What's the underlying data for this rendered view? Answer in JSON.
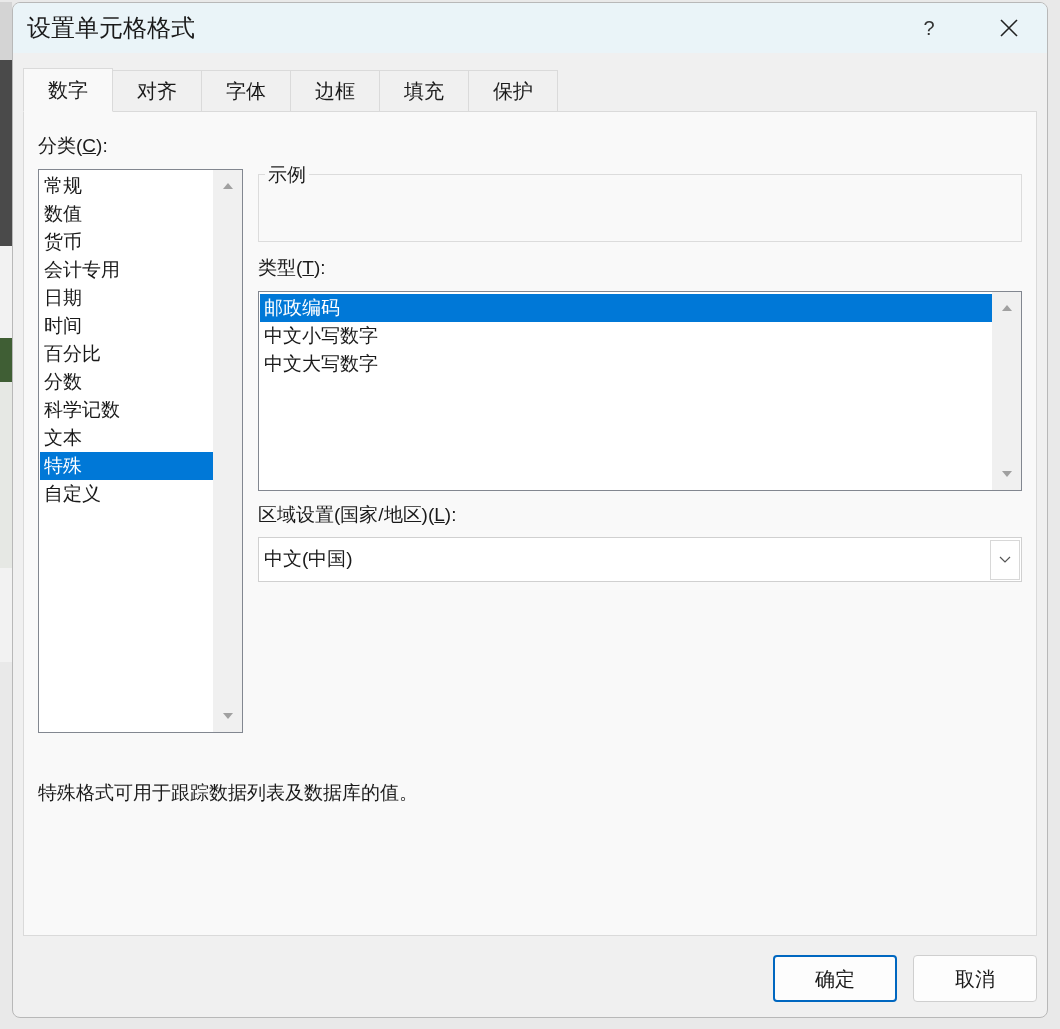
{
  "window": {
    "title": "设置单元格格式",
    "help": "?"
  },
  "tabs": [
    {
      "label": "数字",
      "selected": true
    },
    {
      "label": "对齐",
      "selected": false
    },
    {
      "label": "字体",
      "selected": false
    },
    {
      "label": "边框",
      "selected": false
    },
    {
      "label": "填充",
      "selected": false
    },
    {
      "label": "保护",
      "selected": false
    }
  ],
  "category": {
    "label": [
      "分类(",
      "C",
      "):"
    ],
    "items": [
      {
        "label": "常规",
        "selected": false
      },
      {
        "label": "数值",
        "selected": false
      },
      {
        "label": "货币",
        "selected": false
      },
      {
        "label": "会计专用",
        "selected": false
      },
      {
        "label": "日期",
        "selected": false
      },
      {
        "label": "时间",
        "selected": false
      },
      {
        "label": "百分比",
        "selected": false
      },
      {
        "label": "分数",
        "selected": false
      },
      {
        "label": "科学记数",
        "selected": false
      },
      {
        "label": "文本",
        "selected": false
      },
      {
        "label": "特殊",
        "selected": true
      },
      {
        "label": "自定义",
        "selected": false
      }
    ]
  },
  "sample": {
    "label": "示例"
  },
  "type": {
    "label": [
      "类型(",
      "T",
      "):"
    ],
    "items": [
      {
        "label": "邮政编码",
        "selected": true
      },
      {
        "label": "中文小写数字",
        "selected": false
      },
      {
        "label": "中文大写数字",
        "selected": false
      }
    ]
  },
  "locale": {
    "label": [
      "区域设置(国家/地区)(",
      "L",
      "):"
    ],
    "value": "中文(中国)"
  },
  "description": "特殊格式可用于跟踪数据列表及数据库的值。",
  "buttons": [
    {
      "label": "确定",
      "default": true
    },
    {
      "label": "取消",
      "default": false
    }
  ]
}
